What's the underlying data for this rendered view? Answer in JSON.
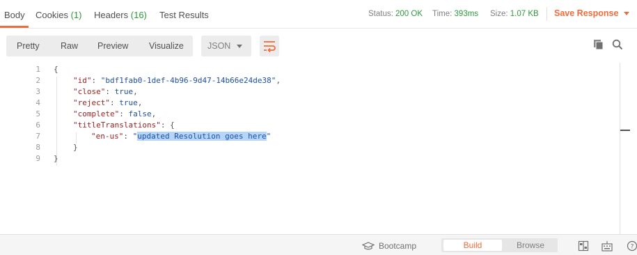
{
  "tabs": [
    {
      "label": "Body",
      "count": ""
    },
    {
      "label": "Cookies",
      "count": "(1)"
    },
    {
      "label": "Headers",
      "count": "(16)"
    },
    {
      "label": "Test Results",
      "count": ""
    }
  ],
  "response_meta": {
    "status_label": "Status:",
    "status_value": "200 OK",
    "time_label": "Time:",
    "time_value": "393ms",
    "size_label": "Size:",
    "size_value": "1.07 KB"
  },
  "save_response_label": "Save Response",
  "view_modes": [
    "Pretty",
    "Raw",
    "Preview",
    "Visualize"
  ],
  "format_select": {
    "value": "JSON"
  },
  "code_lines": [
    {
      "num": "1",
      "text": "{"
    },
    {
      "num": "2",
      "key": "\"id\"",
      "value": "\"bdf1fab0-1def-4b96-9d47-14b66e24de38\"",
      "tail": ","
    },
    {
      "num": "3",
      "key": "\"close\"",
      "value": "true",
      "tail": ","
    },
    {
      "num": "4",
      "key": "\"reject\"",
      "value": "true",
      "tail": ","
    },
    {
      "num": "5",
      "key": "\"complete\"",
      "value": "false",
      "tail": ","
    },
    {
      "num": "6",
      "key": "\"titleTranslations\"",
      "value": "{",
      "tail": ""
    },
    {
      "num": "7",
      "key": "\"en-us\"",
      "value_open": "\"",
      "value_selected": "updated Resolution goes here",
      "value_close": "\""
    },
    {
      "num": "8",
      "text": "}"
    },
    {
      "num": "9",
      "text": "}"
    }
  ],
  "bottom": {
    "bootcamp_label": "Bootcamp",
    "build_label": "Build",
    "browse_label": "Browse"
  },
  "icons": {
    "copy": "copy-icon",
    "search": "search-icon",
    "wrap": "wrap-lines-icon",
    "bootcamp": "graduation-cap-icon",
    "layout": "two-pane-layout-icon",
    "keyboard": "keyboard-icon",
    "help": "help-icon"
  },
  "colors": {
    "accent": "#f26b3a",
    "success": "#2e9a3a",
    "key": "#a11f1f",
    "value": "#1f4fa1",
    "selection": "#b5d5fb"
  }
}
